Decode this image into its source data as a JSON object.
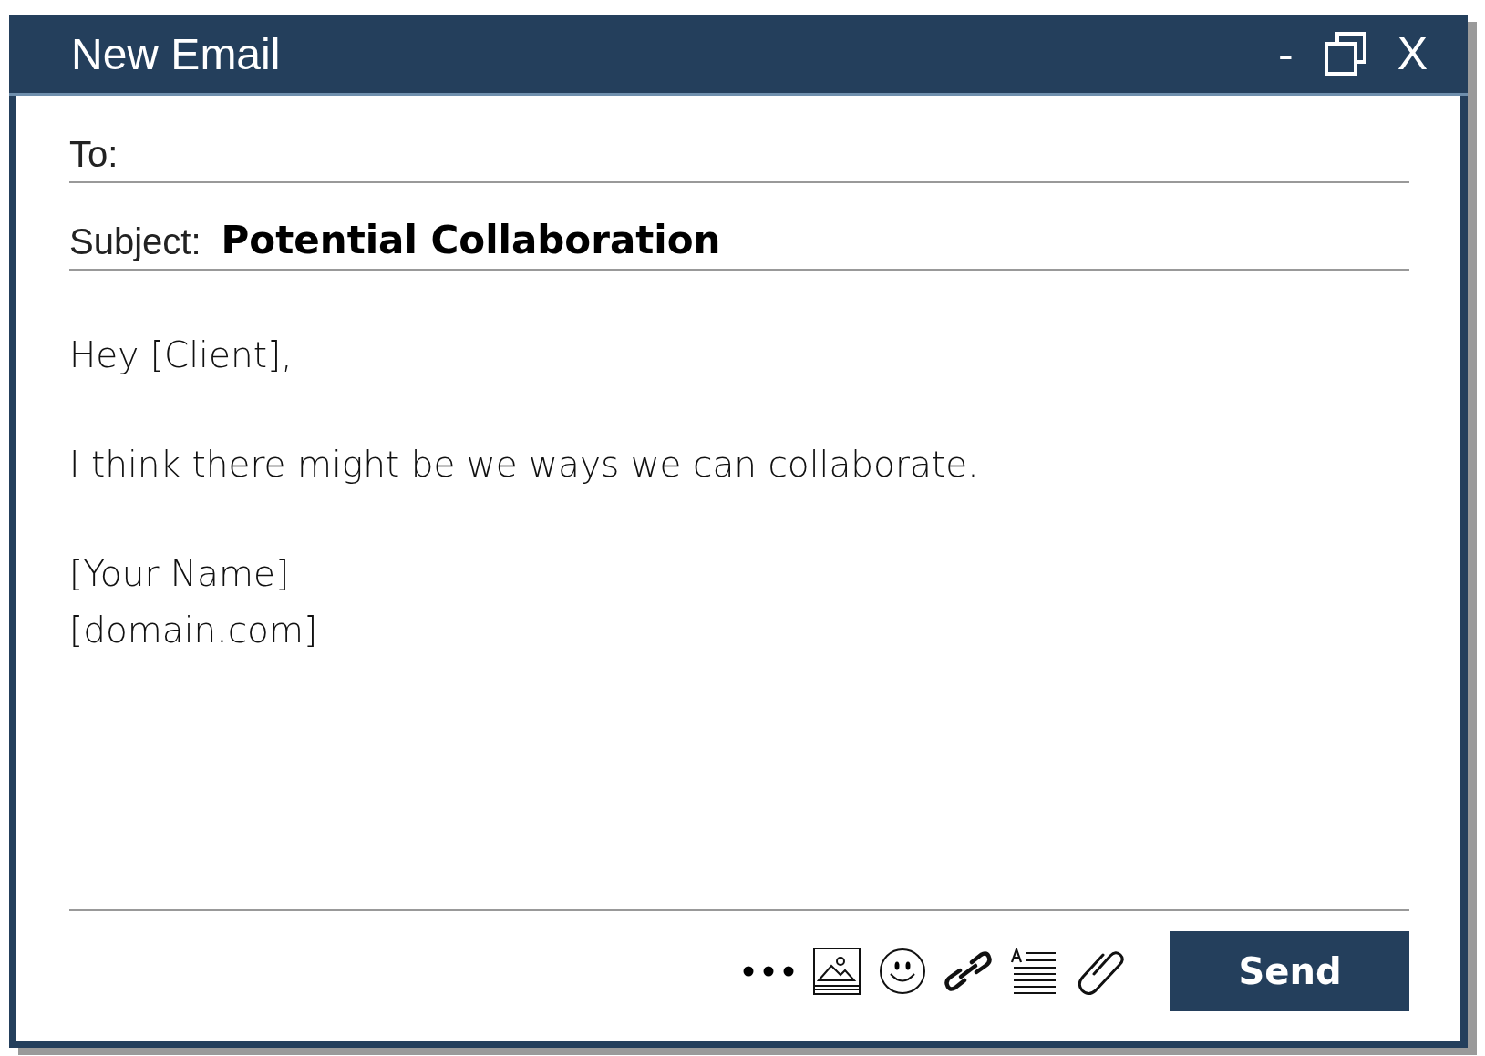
{
  "window": {
    "title": "New Email",
    "controls": [
      "-",
      "X"
    ]
  },
  "to": {
    "label": "To:"
  },
  "subject": {
    "label": "Subject:",
    "value": "Potential Collaboration"
  },
  "body": [
    [
      "Hey [Client],"
    ],
    [
      "I think there might be we ways we can collaborate."
    ],
    [
      "[Your Name]",
      "[domain.com]"
    ]
  ],
  "send_button": "Send"
}
